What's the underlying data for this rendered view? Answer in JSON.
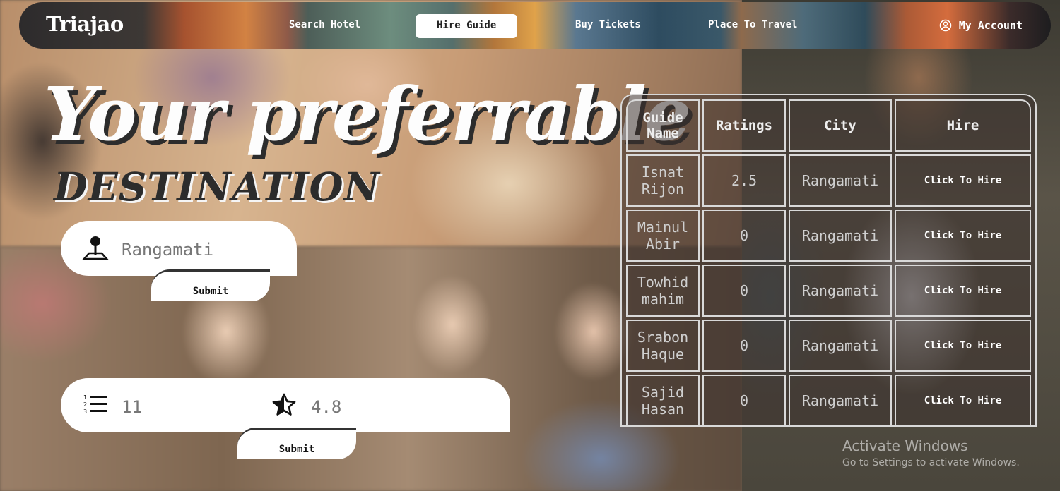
{
  "nav": {
    "logo": "Triajao",
    "links": [
      "Search Hotel",
      "Hire Guide",
      "Buy Tickets",
      "Place To Travel"
    ],
    "active_link": "Hire Guide",
    "account": "My Account"
  },
  "hero": {
    "title": "Your preferrable",
    "subtitle": "DESTINATION"
  },
  "search": {
    "location_value": "Rangamati",
    "submit_label": "Submit"
  },
  "filter": {
    "count": "11",
    "rating": "4.8",
    "submit_label": "Submit"
  },
  "table": {
    "headers": [
      "Guide Name",
      "Ratings",
      "City",
      "Hire"
    ],
    "rows": [
      {
        "name": "Isnat Rijon",
        "rating": "2.5",
        "city": "Rangamati",
        "hire": "Click To Hire"
      },
      {
        "name": "Mainul Abir",
        "rating": "0",
        "city": "Rangamati",
        "hire": "Click To Hire"
      },
      {
        "name": "Towhid mahim",
        "rating": "0",
        "city": "Rangamati",
        "hire": "Click To Hire"
      },
      {
        "name": "Srabon Haque",
        "rating": "0",
        "city": "Rangamati",
        "hire": "Click To Hire"
      },
      {
        "name": "Sajid Hasan",
        "rating": "0",
        "city": "Rangamati",
        "hire": "Click To Hire"
      }
    ]
  },
  "watermark": {
    "line1": "Activate Windows",
    "line2": "Go to Settings to activate Windows."
  },
  "icons": {
    "location": "location-pin-icon",
    "list": "numbered-list-icon",
    "star": "half-star-icon",
    "account": "user-circle-icon"
  }
}
